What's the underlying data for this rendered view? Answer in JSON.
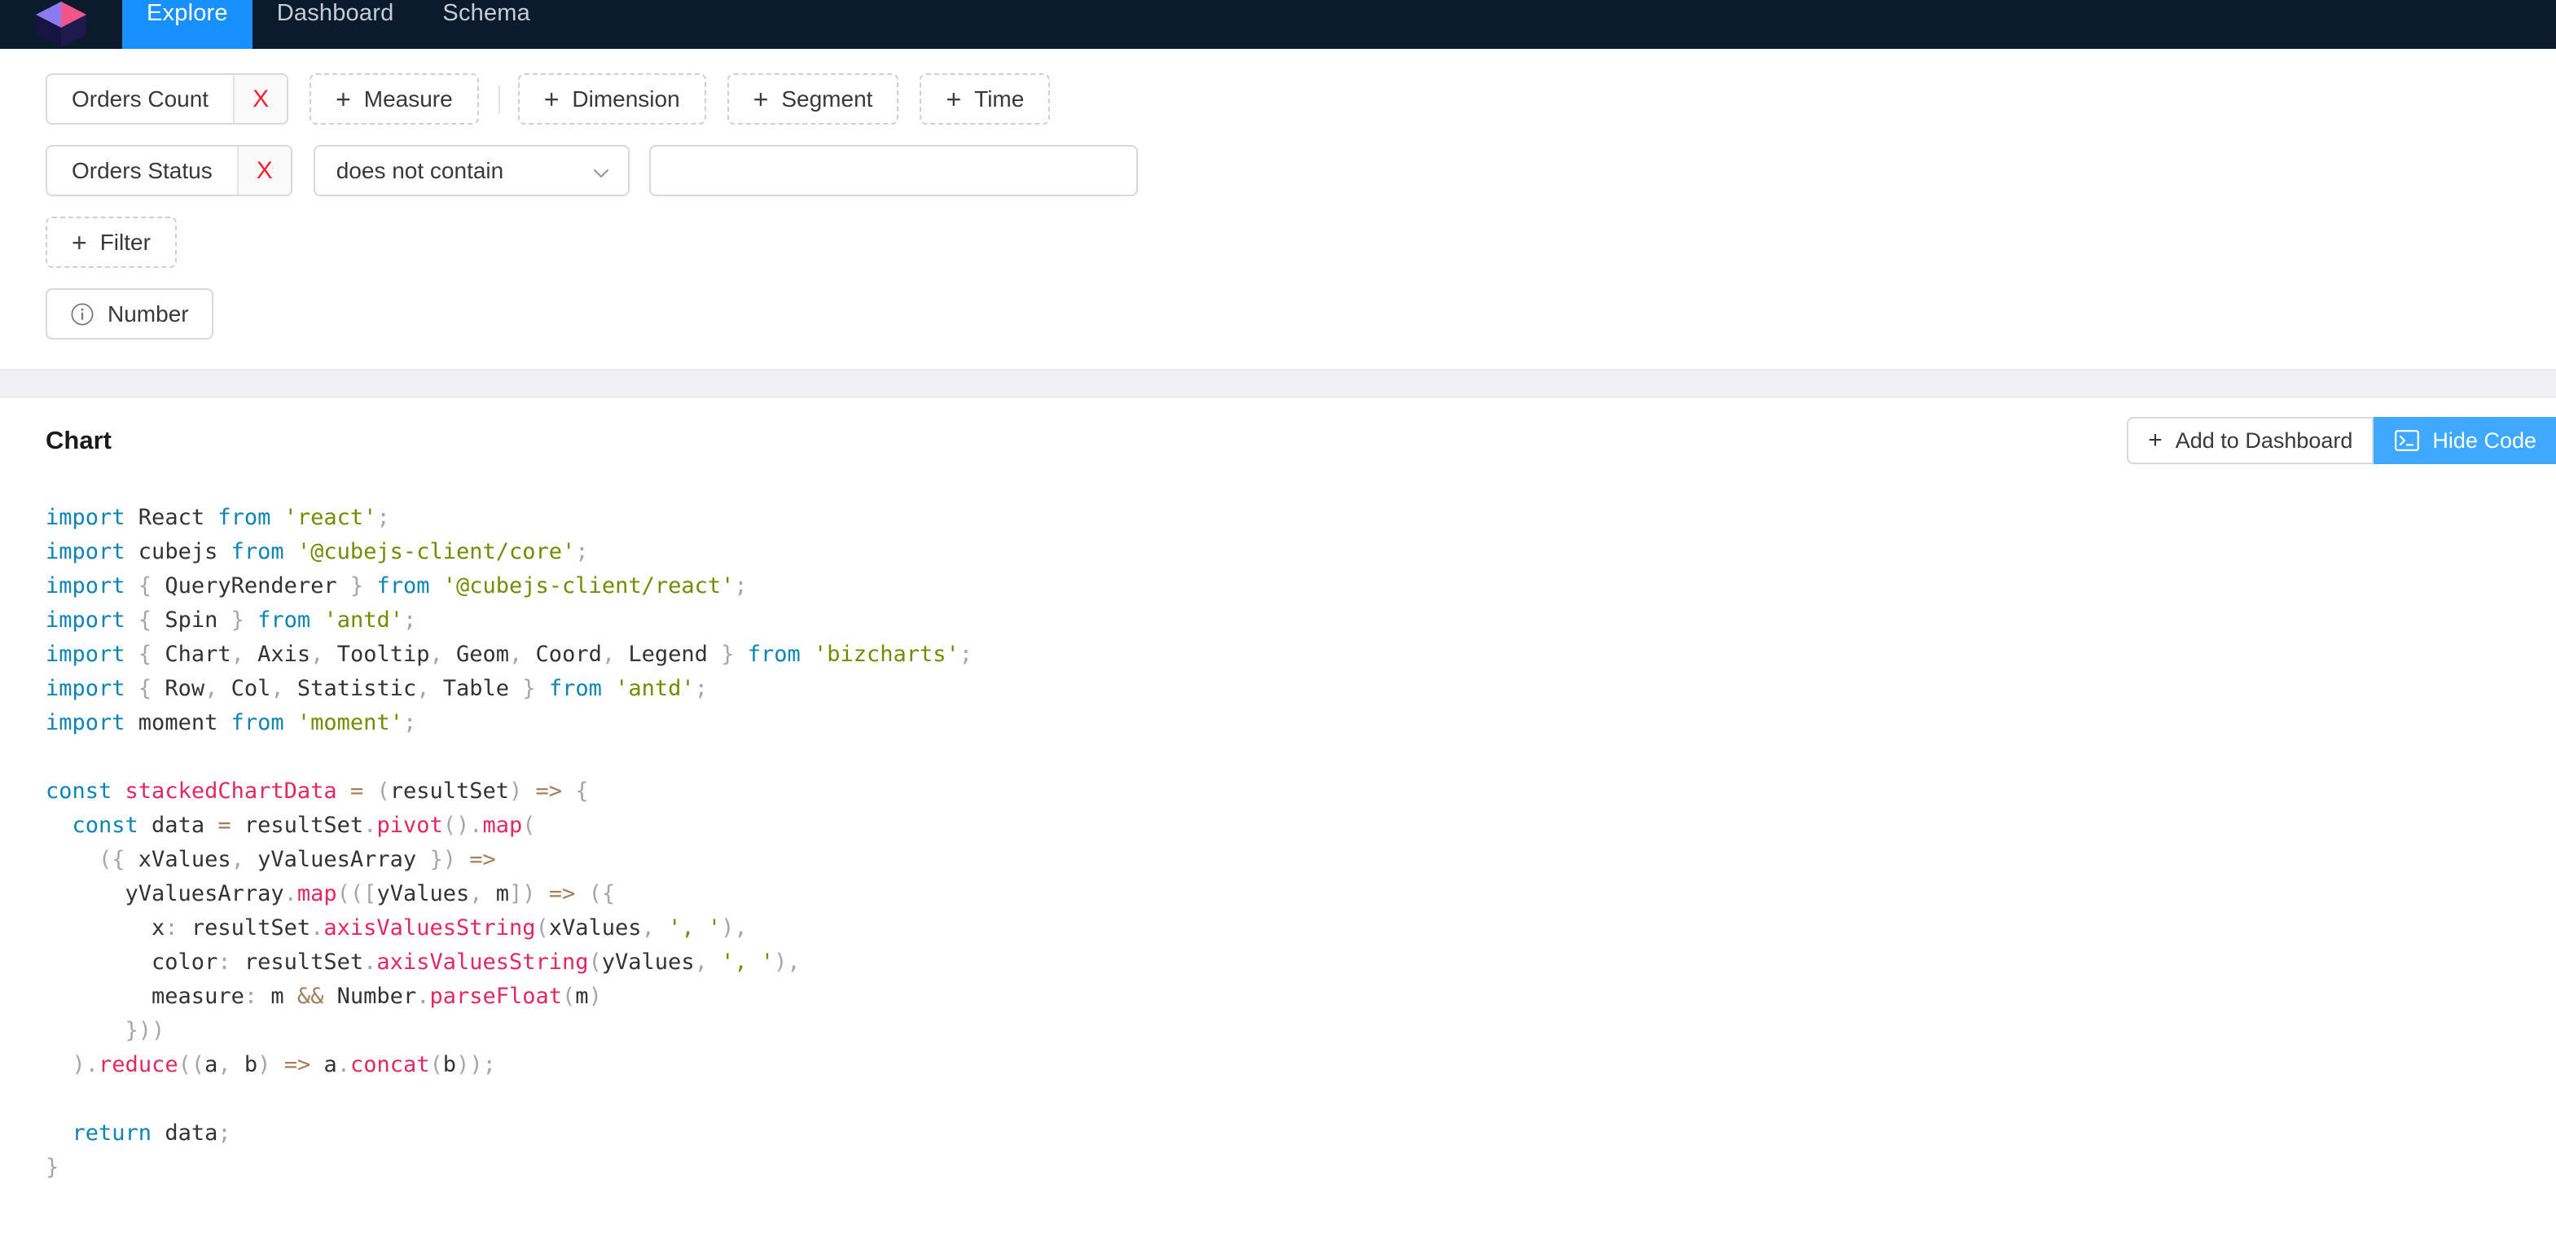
{
  "nav": {
    "logo_icon": "cube-logo-icon",
    "tabs": [
      {
        "label": "Explore",
        "active": true
      },
      {
        "label": "Dashboard",
        "active": false
      },
      {
        "label": "Schema",
        "active": false
      }
    ]
  },
  "query_builder": {
    "members": [
      {
        "label": "Orders Count",
        "remove_label": "X",
        "remove_icon": "close-x-icon"
      }
    ],
    "add_buttons": [
      {
        "label": "Measure",
        "plus": "+"
      },
      {
        "label": "Dimension",
        "plus": "+"
      },
      {
        "label": "Segment",
        "plus": "+"
      },
      {
        "label": "Time",
        "plus": "+"
      }
    ],
    "filter": {
      "member_label": "Orders Status",
      "remove_label": "X",
      "operator": "does not contain",
      "operator_icon": "chevron-down-icon",
      "value": "",
      "value_placeholder": ""
    },
    "add_filter": {
      "label": "Filter",
      "plus": "+"
    },
    "viz_type": {
      "label": "Number",
      "icon": "info-circle-icon"
    }
  },
  "chart_section": {
    "title": "Chart",
    "add_to_dashboard": {
      "label": "Add to Dashboard",
      "plus": "+"
    },
    "hide_code": {
      "label": "Hide Code",
      "icon": "terminal-icon"
    }
  },
  "code": {
    "language": "javascript",
    "lines": [
      [
        {
          "t": "import",
          "c": "k"
        },
        {
          "t": " React ",
          "c": "pl"
        },
        {
          "t": "from",
          "c": "k"
        },
        {
          "t": " ",
          "c": "pl"
        },
        {
          "t": "'react'",
          "c": "s"
        },
        {
          "t": ";",
          "c": "p"
        }
      ],
      [
        {
          "t": "import",
          "c": "k"
        },
        {
          "t": " cubejs ",
          "c": "pl"
        },
        {
          "t": "from",
          "c": "k"
        },
        {
          "t": " ",
          "c": "pl"
        },
        {
          "t": "'@cubejs-client/core'",
          "c": "s"
        },
        {
          "t": ";",
          "c": "p"
        }
      ],
      [
        {
          "t": "import",
          "c": "k"
        },
        {
          "t": " ",
          "c": "pl"
        },
        {
          "t": "{",
          "c": "p"
        },
        {
          "t": " QueryRenderer ",
          "c": "pl"
        },
        {
          "t": "}",
          "c": "p"
        },
        {
          "t": " ",
          "c": "pl"
        },
        {
          "t": "from",
          "c": "k"
        },
        {
          "t": " ",
          "c": "pl"
        },
        {
          "t": "'@cubejs-client/react'",
          "c": "s"
        },
        {
          "t": ";",
          "c": "p"
        }
      ],
      [
        {
          "t": "import",
          "c": "k"
        },
        {
          "t": " ",
          "c": "pl"
        },
        {
          "t": "{",
          "c": "p"
        },
        {
          "t": " Spin ",
          "c": "pl"
        },
        {
          "t": "}",
          "c": "p"
        },
        {
          "t": " ",
          "c": "pl"
        },
        {
          "t": "from",
          "c": "k"
        },
        {
          "t": " ",
          "c": "pl"
        },
        {
          "t": "'antd'",
          "c": "s"
        },
        {
          "t": ";",
          "c": "p"
        }
      ],
      [
        {
          "t": "import",
          "c": "k"
        },
        {
          "t": " ",
          "c": "pl"
        },
        {
          "t": "{",
          "c": "p"
        },
        {
          "t": " Chart",
          "c": "pl"
        },
        {
          "t": ",",
          "c": "p"
        },
        {
          "t": " Axis",
          "c": "pl"
        },
        {
          "t": ",",
          "c": "p"
        },
        {
          "t": " Tooltip",
          "c": "pl"
        },
        {
          "t": ",",
          "c": "p"
        },
        {
          "t": " Geom",
          "c": "pl"
        },
        {
          "t": ",",
          "c": "p"
        },
        {
          "t": " Coord",
          "c": "pl"
        },
        {
          "t": ",",
          "c": "p"
        },
        {
          "t": " Legend ",
          "c": "pl"
        },
        {
          "t": "}",
          "c": "p"
        },
        {
          "t": " ",
          "c": "pl"
        },
        {
          "t": "from",
          "c": "k"
        },
        {
          "t": " ",
          "c": "pl"
        },
        {
          "t": "'bizcharts'",
          "c": "s"
        },
        {
          "t": ";",
          "c": "p"
        }
      ],
      [
        {
          "t": "import",
          "c": "k"
        },
        {
          "t": " ",
          "c": "pl"
        },
        {
          "t": "{",
          "c": "p"
        },
        {
          "t": " Row",
          "c": "pl"
        },
        {
          "t": ",",
          "c": "p"
        },
        {
          "t": " Col",
          "c": "pl"
        },
        {
          "t": ",",
          "c": "p"
        },
        {
          "t": " Statistic",
          "c": "pl"
        },
        {
          "t": ",",
          "c": "p"
        },
        {
          "t": " Table ",
          "c": "pl"
        },
        {
          "t": "}",
          "c": "p"
        },
        {
          "t": " ",
          "c": "pl"
        },
        {
          "t": "from",
          "c": "k"
        },
        {
          "t": " ",
          "c": "pl"
        },
        {
          "t": "'antd'",
          "c": "s"
        },
        {
          "t": ";",
          "c": "p"
        }
      ],
      [
        {
          "t": "import",
          "c": "k"
        },
        {
          "t": " moment ",
          "c": "pl"
        },
        {
          "t": "from",
          "c": "k"
        },
        {
          "t": " ",
          "c": "pl"
        },
        {
          "t": "'moment'",
          "c": "s"
        },
        {
          "t": ";",
          "c": "p"
        }
      ],
      [],
      [
        {
          "t": "const",
          "c": "k"
        },
        {
          "t": " ",
          "c": "pl"
        },
        {
          "t": "stackedChartData",
          "c": "f"
        },
        {
          "t": " ",
          "c": "pl"
        },
        {
          "t": "=",
          "c": "op"
        },
        {
          "t": " ",
          "c": "pl"
        },
        {
          "t": "(",
          "c": "p"
        },
        {
          "t": "resultSet",
          "c": "pl"
        },
        {
          "t": ")",
          "c": "p"
        },
        {
          "t": " ",
          "c": "pl"
        },
        {
          "t": "=>",
          "c": "op"
        },
        {
          "t": " ",
          "c": "pl"
        },
        {
          "t": "{",
          "c": "p"
        }
      ],
      [
        {
          "t": "  ",
          "c": "pl"
        },
        {
          "t": "const",
          "c": "k"
        },
        {
          "t": " data ",
          "c": "pl"
        },
        {
          "t": "=",
          "c": "op"
        },
        {
          "t": " resultSet",
          "c": "pl"
        },
        {
          "t": ".",
          "c": "p"
        },
        {
          "t": "pivot",
          "c": "f"
        },
        {
          "t": "()",
          "c": "p"
        },
        {
          "t": ".",
          "c": "p"
        },
        {
          "t": "map",
          "c": "f"
        },
        {
          "t": "(",
          "c": "p"
        }
      ],
      [
        {
          "t": "    ",
          "c": "pl"
        },
        {
          "t": "({",
          "c": "p"
        },
        {
          "t": " xValues",
          "c": "pl"
        },
        {
          "t": ",",
          "c": "p"
        },
        {
          "t": " yValuesArray ",
          "c": "pl"
        },
        {
          "t": "})",
          "c": "p"
        },
        {
          "t": " ",
          "c": "pl"
        },
        {
          "t": "=>",
          "c": "op"
        }
      ],
      [
        {
          "t": "      yValuesArray",
          "c": "pl"
        },
        {
          "t": ".",
          "c": "p"
        },
        {
          "t": "map",
          "c": "f"
        },
        {
          "t": "((",
          "c": "p"
        },
        {
          "t": "[",
          "c": "p"
        },
        {
          "t": "yValues",
          "c": "pl"
        },
        {
          "t": ",",
          "c": "p"
        },
        {
          "t": " m",
          "c": "pl"
        },
        {
          "t": "])",
          "c": "p"
        },
        {
          "t": " ",
          "c": "pl"
        },
        {
          "t": "=>",
          "c": "op"
        },
        {
          "t": " ",
          "c": "pl"
        },
        {
          "t": "({",
          "c": "p"
        }
      ],
      [
        {
          "t": "        x",
          "c": "pl"
        },
        {
          "t": ":",
          "c": "p"
        },
        {
          "t": " resultSet",
          "c": "pl"
        },
        {
          "t": ".",
          "c": "p"
        },
        {
          "t": "axisValuesString",
          "c": "f"
        },
        {
          "t": "(",
          "c": "p"
        },
        {
          "t": "xValues",
          "c": "pl"
        },
        {
          "t": ",",
          "c": "p"
        },
        {
          "t": " ",
          "c": "pl"
        },
        {
          "t": "', '",
          "c": "s"
        },
        {
          "t": "),",
          "c": "p"
        }
      ],
      [
        {
          "t": "        color",
          "c": "pl"
        },
        {
          "t": ":",
          "c": "p"
        },
        {
          "t": " resultSet",
          "c": "pl"
        },
        {
          "t": ".",
          "c": "p"
        },
        {
          "t": "axisValuesString",
          "c": "f"
        },
        {
          "t": "(",
          "c": "p"
        },
        {
          "t": "yValues",
          "c": "pl"
        },
        {
          "t": ",",
          "c": "p"
        },
        {
          "t": " ",
          "c": "pl"
        },
        {
          "t": "', '",
          "c": "s"
        },
        {
          "t": "),",
          "c": "p"
        }
      ],
      [
        {
          "t": "        measure",
          "c": "pl"
        },
        {
          "t": ":",
          "c": "p"
        },
        {
          "t": " m ",
          "c": "pl"
        },
        {
          "t": "&&",
          "c": "op"
        },
        {
          "t": " Number",
          "c": "pl"
        },
        {
          "t": ".",
          "c": "p"
        },
        {
          "t": "parseFloat",
          "c": "f"
        },
        {
          "t": "(",
          "c": "p"
        },
        {
          "t": "m",
          "c": "pl"
        },
        {
          "t": ")",
          "c": "p"
        }
      ],
      [
        {
          "t": "      ",
          "c": "pl"
        },
        {
          "t": "}))",
          "c": "p"
        }
      ],
      [
        {
          "t": "  ",
          "c": "pl"
        },
        {
          "t": ")",
          "c": "p"
        },
        {
          "t": ".",
          "c": "p"
        },
        {
          "t": "reduce",
          "c": "f"
        },
        {
          "t": "((",
          "c": "p"
        },
        {
          "t": "a",
          "c": "pl"
        },
        {
          "t": ",",
          "c": "p"
        },
        {
          "t": " b",
          "c": "pl"
        },
        {
          "t": ")",
          "c": "p"
        },
        {
          "t": " ",
          "c": "pl"
        },
        {
          "t": "=>",
          "c": "op"
        },
        {
          "t": " a",
          "c": "pl"
        },
        {
          "t": ".",
          "c": "p"
        },
        {
          "t": "concat",
          "c": "f"
        },
        {
          "t": "(",
          "c": "p"
        },
        {
          "t": "b",
          "c": "pl"
        },
        {
          "t": "));",
          "c": "p"
        }
      ],
      [],
      [
        {
          "t": "  ",
          "c": "pl"
        },
        {
          "t": "return",
          "c": "k"
        },
        {
          "t": " data",
          "c": "pl"
        },
        {
          "t": ";",
          "c": "p"
        }
      ],
      [
        {
          "t": "}",
          "c": "p"
        }
      ]
    ]
  },
  "colors": {
    "nav_bg": "#0b1a2c",
    "nav_active": "#1890ff",
    "primary": "#40a9ff",
    "remove_x": "#f5222d",
    "band_bg": "#f0f0f4",
    "code_keyword": "#0e84b5",
    "code_string": "#718c00",
    "code_function": "#e4285e",
    "code_operator": "#a67f59",
    "code_punct": "#a6a6a6"
  }
}
